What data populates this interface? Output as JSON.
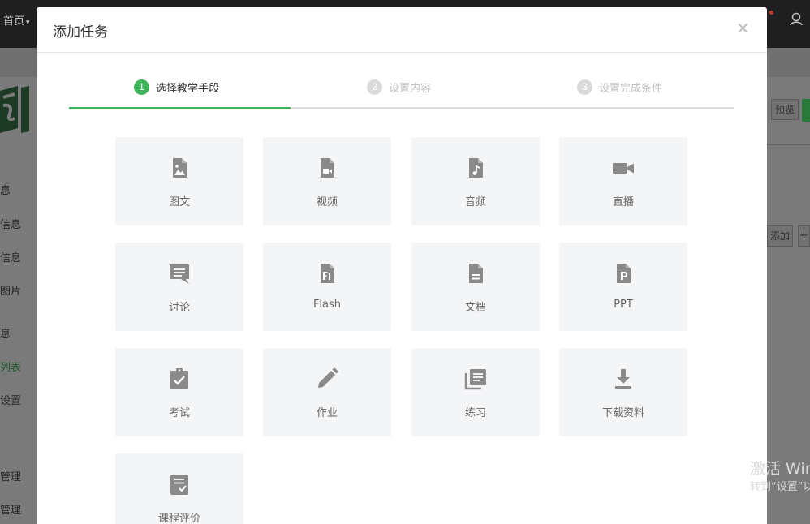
{
  "background": {
    "nav_home": "首页",
    "preview_button": "预览",
    "add_button": "添加",
    "plus_button": "+",
    "sidebar_fragments": [
      "息",
      "信息",
      "信息",
      "图片",
      "息",
      "列表",
      "设置",
      "管理",
      "管理"
    ],
    "watermark_line1": "激活 Win",
    "watermark_line2": "转到“设置”以"
  },
  "modal": {
    "title": "添加任务",
    "close_glyph": "×",
    "steps": [
      {
        "number": "1",
        "label": "选择教学手段",
        "state": "active"
      },
      {
        "number": "2",
        "label": "设置内容",
        "state": "inactive"
      },
      {
        "number": "3",
        "label": "设置完成条件",
        "state": "inactive"
      }
    ],
    "task_types": [
      {
        "label": "图文",
        "icon": "image-file-icon"
      },
      {
        "label": "视频",
        "icon": "video-file-icon"
      },
      {
        "label": "音频",
        "icon": "audio-file-icon"
      },
      {
        "label": "直播",
        "icon": "video-camera-icon"
      },
      {
        "label": "讨论",
        "icon": "discussion-icon"
      },
      {
        "label": "Flash",
        "icon": "flash-file-icon"
      },
      {
        "label": "文档",
        "icon": "document-icon"
      },
      {
        "label": "PPT",
        "icon": "ppt-file-icon"
      },
      {
        "label": "考试",
        "icon": "exam-clipboard-icon"
      },
      {
        "label": "作业",
        "icon": "pencil-icon"
      },
      {
        "label": "练习",
        "icon": "practice-library-icon"
      },
      {
        "label": "下载资料",
        "icon": "download-icon"
      },
      {
        "label": "课程评价",
        "icon": "evaluation-icon"
      }
    ]
  },
  "colors": {
    "accent_green": "#3cb55a",
    "icon_gray": "#8a8a8a",
    "card_bg": "#f4f5f7"
  }
}
